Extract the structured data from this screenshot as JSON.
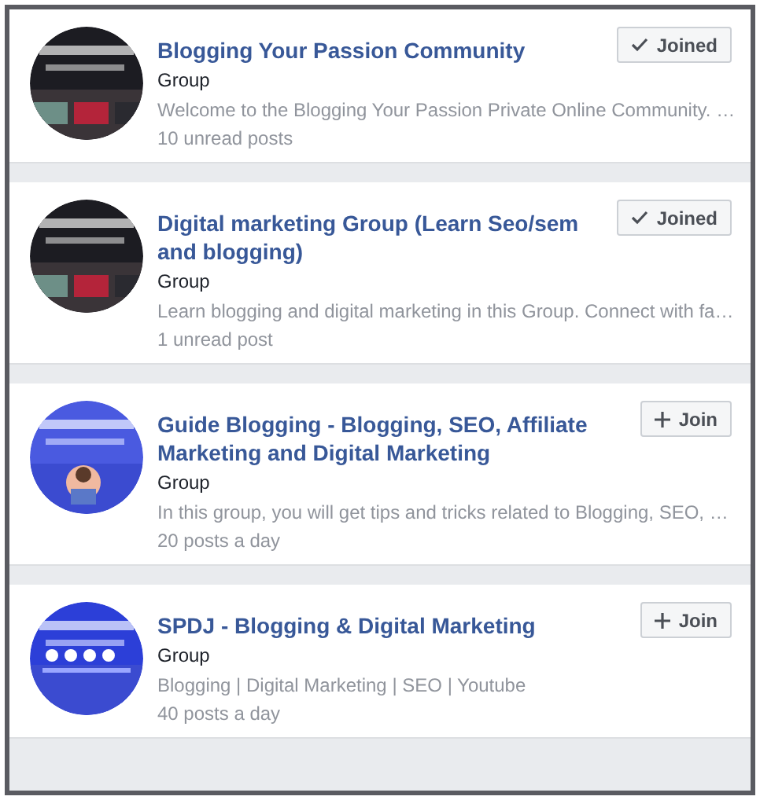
{
  "groups": [
    {
      "name": "Blogging Your Passion Community",
      "type": "Group",
      "description": "Welcome to the Blogging Your Passion Private Online Community. …",
      "activity": "10 unread posts",
      "joined": true,
      "button": "Joined"
    },
    {
      "name": "Digital marketing Group (Learn Seo/sem and blogging)",
      "type": "Group",
      "description": "Learn blogging and digital marketing in this Group. Connect with fa…",
      "activity": "1 unread post",
      "joined": true,
      "button": "Joined"
    },
    {
      "name": "Guide Blogging - Blogging, SEO, Affiliate Marketing and Digital Marketing",
      "type": "Group",
      "description": "In this group, you will get tips and tricks related to Blogging, SEO, …",
      "activity": "20 posts a day",
      "joined": false,
      "button": "Join"
    },
    {
      "name": "SPDJ - Blogging & Digital Marketing",
      "type": "Group",
      "description": "Blogging | Digital Marketing | SEO | Youtube",
      "activity": "40 posts a day",
      "joined": false,
      "button": "Join"
    }
  ]
}
